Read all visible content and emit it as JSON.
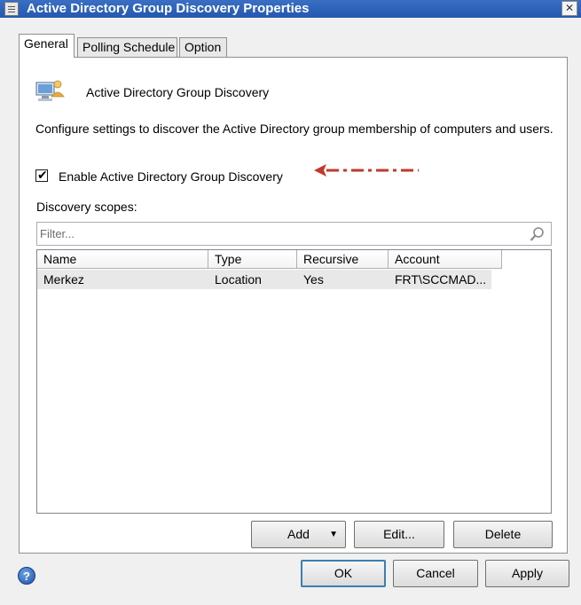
{
  "window": {
    "title": "Active Directory Group Discovery Properties",
    "close_glyph": "✕"
  },
  "tabs": [
    {
      "label": "General",
      "active": true
    },
    {
      "label": "Polling Schedule",
      "active": false
    },
    {
      "label": "Option",
      "active": false
    }
  ],
  "general": {
    "header_title": "Active Directory Group Discovery",
    "header_icon": "computer-users-icon",
    "description": "Configure settings to discover the Active Directory group membership of computers and users.",
    "enable_checkbox": {
      "label": "Enable Active Directory Group Discovery",
      "checked": true
    },
    "annotation": {
      "icon": "red-dash-dot-arrow-icon",
      "color": "#c0392b"
    },
    "scopes_label": "Discovery scopes:",
    "filter_placeholder": "Filter...",
    "table": {
      "columns": [
        "Name",
        "Type",
        "Recursive",
        "Account"
      ],
      "rows": [
        [
          "Merkez",
          "Location",
          "Yes",
          "FRT\\SCCMAD..."
        ]
      ]
    },
    "buttons": {
      "add": "Add",
      "add_arrow": "▼",
      "edit": "Edit...",
      "delete": "Delete"
    }
  },
  "footer": {
    "help_glyph": "?",
    "ok": "OK",
    "cancel": "Cancel",
    "apply": "Apply"
  },
  "colors": {
    "titlebar": "#2457b0",
    "annotation_arrow": "#c0392b",
    "selected_row": "#e8e8e8"
  }
}
